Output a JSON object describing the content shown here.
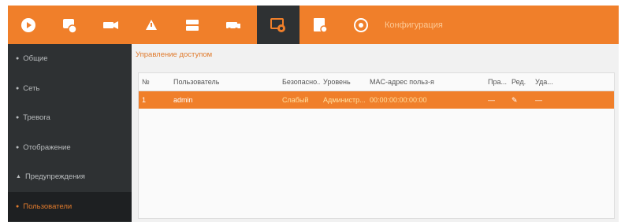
{
  "toolbar": {
    "items": [
      {
        "icon": "live-view-icon"
      },
      {
        "icon": "playback-icon"
      },
      {
        "icon": "camera-icon"
      },
      {
        "icon": "event-icon"
      },
      {
        "icon": "storage-icon"
      },
      {
        "icon": "vehicle-icon"
      },
      {
        "icon": "configuration-icon",
        "active": true
      },
      {
        "icon": "device-icon"
      },
      {
        "icon": "info-icon"
      }
    ],
    "title": "Конфигурация",
    "accent": "#f07f2a",
    "dark": "#2e3133"
  },
  "sidebar": {
    "items": [
      {
        "label": "Общие"
      },
      {
        "label": "Сеть"
      },
      {
        "label": "Тревога"
      },
      {
        "label": "Отображение"
      },
      {
        "label": "Предупреждения"
      },
      {
        "label": "Пользователи",
        "active": true
      }
    ]
  },
  "main": {
    "section_title": "Управление доступом",
    "table": {
      "columns": [
        "№",
        "Пользователь",
        "Безопасно...",
        "Уровень",
        "MAC-адрес польз-я",
        "Пра...",
        "Ред.",
        "Уда..."
      ],
      "rows": [
        {
          "no": "1",
          "user": "admin",
          "security": "Слабый",
          "level": "Администр...",
          "mac": "00:00:00:00:00:00",
          "perm": "—",
          "edit": "✎",
          "del": "—"
        }
      ]
    }
  }
}
